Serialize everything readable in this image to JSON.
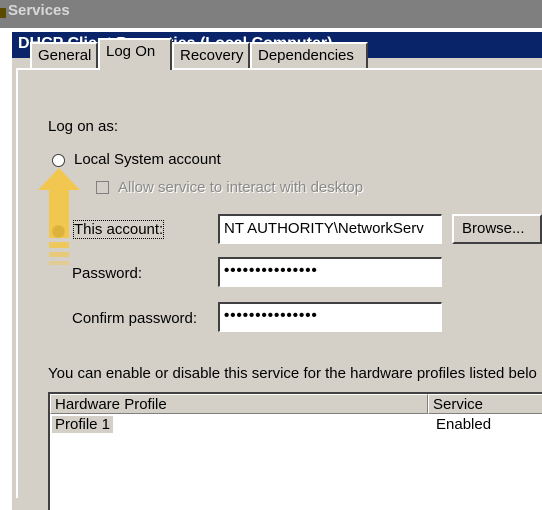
{
  "background_window": {
    "title": "Services"
  },
  "dialog": {
    "title": "DHCP Client Properties (Local Computer)",
    "tabs": [
      {
        "label": "General",
        "active": false
      },
      {
        "label": "Log On",
        "active": true
      },
      {
        "label": "Recovery",
        "active": false
      },
      {
        "label": "Dependencies",
        "active": false
      }
    ]
  },
  "logon": {
    "log_on_as_label": "Log on as:",
    "local_system_label": "Local System account",
    "allow_interact_label": "Allow service to interact with desktop",
    "this_account_label": "This account:",
    "this_account_value": "NT AUTHORITY\\NetworkServ",
    "browse_label": "Browse...",
    "password_label": "Password:",
    "password_value": "•••••••••••••••",
    "confirm_label": "Confirm password:",
    "confirm_value": "•••••••••••••••",
    "hw_note": "You can enable or disable this service for the hardware profiles listed belo"
  },
  "hardware_profiles": {
    "columns": [
      "Hardware Profile",
      "Service"
    ],
    "rows": [
      {
        "profile": "Profile 1",
        "service": "Enabled"
      }
    ]
  },
  "colors": {
    "titlebar": "#0a246a",
    "dialog_face": "#d4d0c8",
    "highlight_arrow": "#f5c542"
  },
  "icons": {
    "arrow": "up-arrow-icon"
  }
}
